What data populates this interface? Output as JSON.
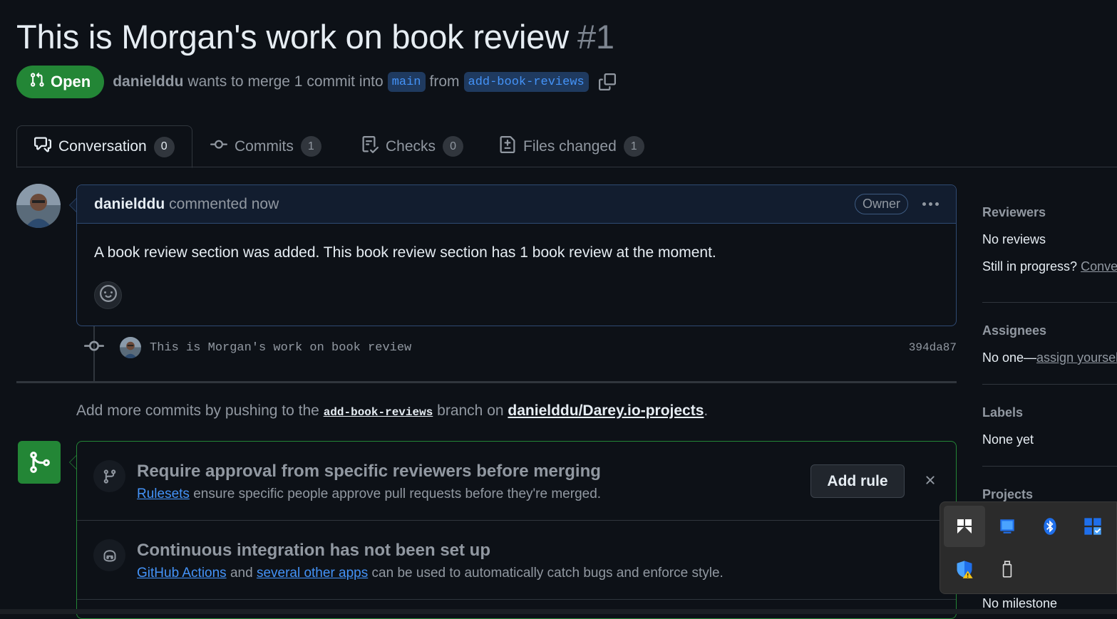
{
  "pr": {
    "title": "This is Morgan's work on book review",
    "number": "#1",
    "status": "Open",
    "author": "danielddu",
    "merge_text": "wants to merge 1 commit into",
    "base_branch": "main",
    "from_text": "from",
    "head_branch": "add-book-reviews"
  },
  "tabs": [
    {
      "label": "Conversation",
      "count": "0",
      "icon": "comment-discussion-icon"
    },
    {
      "label": "Commits",
      "count": "1",
      "icon": "git-commit-icon"
    },
    {
      "label": "Checks",
      "count": "0",
      "icon": "checklist-icon"
    },
    {
      "label": "Files changed",
      "count": "1",
      "icon": "file-diff-icon"
    }
  ],
  "comment": {
    "author": "danielddu",
    "when": "commented now",
    "role": "Owner",
    "body": "A book review section was added. This book review section has 1 book review at the moment."
  },
  "commit": {
    "message": "This is Morgan's work on book review",
    "sha": "394da87"
  },
  "hint": {
    "prefix": "Add more commits by pushing to the",
    "branch": "add-book-reviews",
    "middle": "branch on",
    "repo": "danielddu/Darey.io-projects",
    "suffix": "."
  },
  "merge": {
    "rulesets": {
      "title": "Require approval from specific reviewers before merging",
      "link": "Rulesets",
      "desc": "ensure specific people approve pull requests before they're merged.",
      "button": "Add rule"
    },
    "ci": {
      "title": "Continuous integration has not been set up",
      "link1": "GitHub Actions",
      "and": "and",
      "link2": "several other apps",
      "desc": "can be used to automatically catch bugs and enforce style."
    }
  },
  "sidebar": {
    "reviewers": {
      "title": "Reviewers",
      "value": "No reviews",
      "progress_text": "Still in progress?",
      "progress_link": "Convert to draft"
    },
    "assignees": {
      "title": "Assignees",
      "value": "No one—",
      "link": "assign yourself"
    },
    "labels": {
      "title": "Labels",
      "value": "None yet"
    },
    "projects": {
      "title": "Projects"
    },
    "milestone": {
      "value": "No milestone"
    }
  },
  "tray": {
    "icons": [
      "pinned-app-icon",
      "windows-update-icon",
      "bluetooth-icon",
      "task-manager-icon",
      "security-warning-icon",
      "usb-drive-icon"
    ]
  },
  "colors": {
    "accent_green": "#238636",
    "link_blue": "#4493f8",
    "bg": "#0d1117"
  }
}
